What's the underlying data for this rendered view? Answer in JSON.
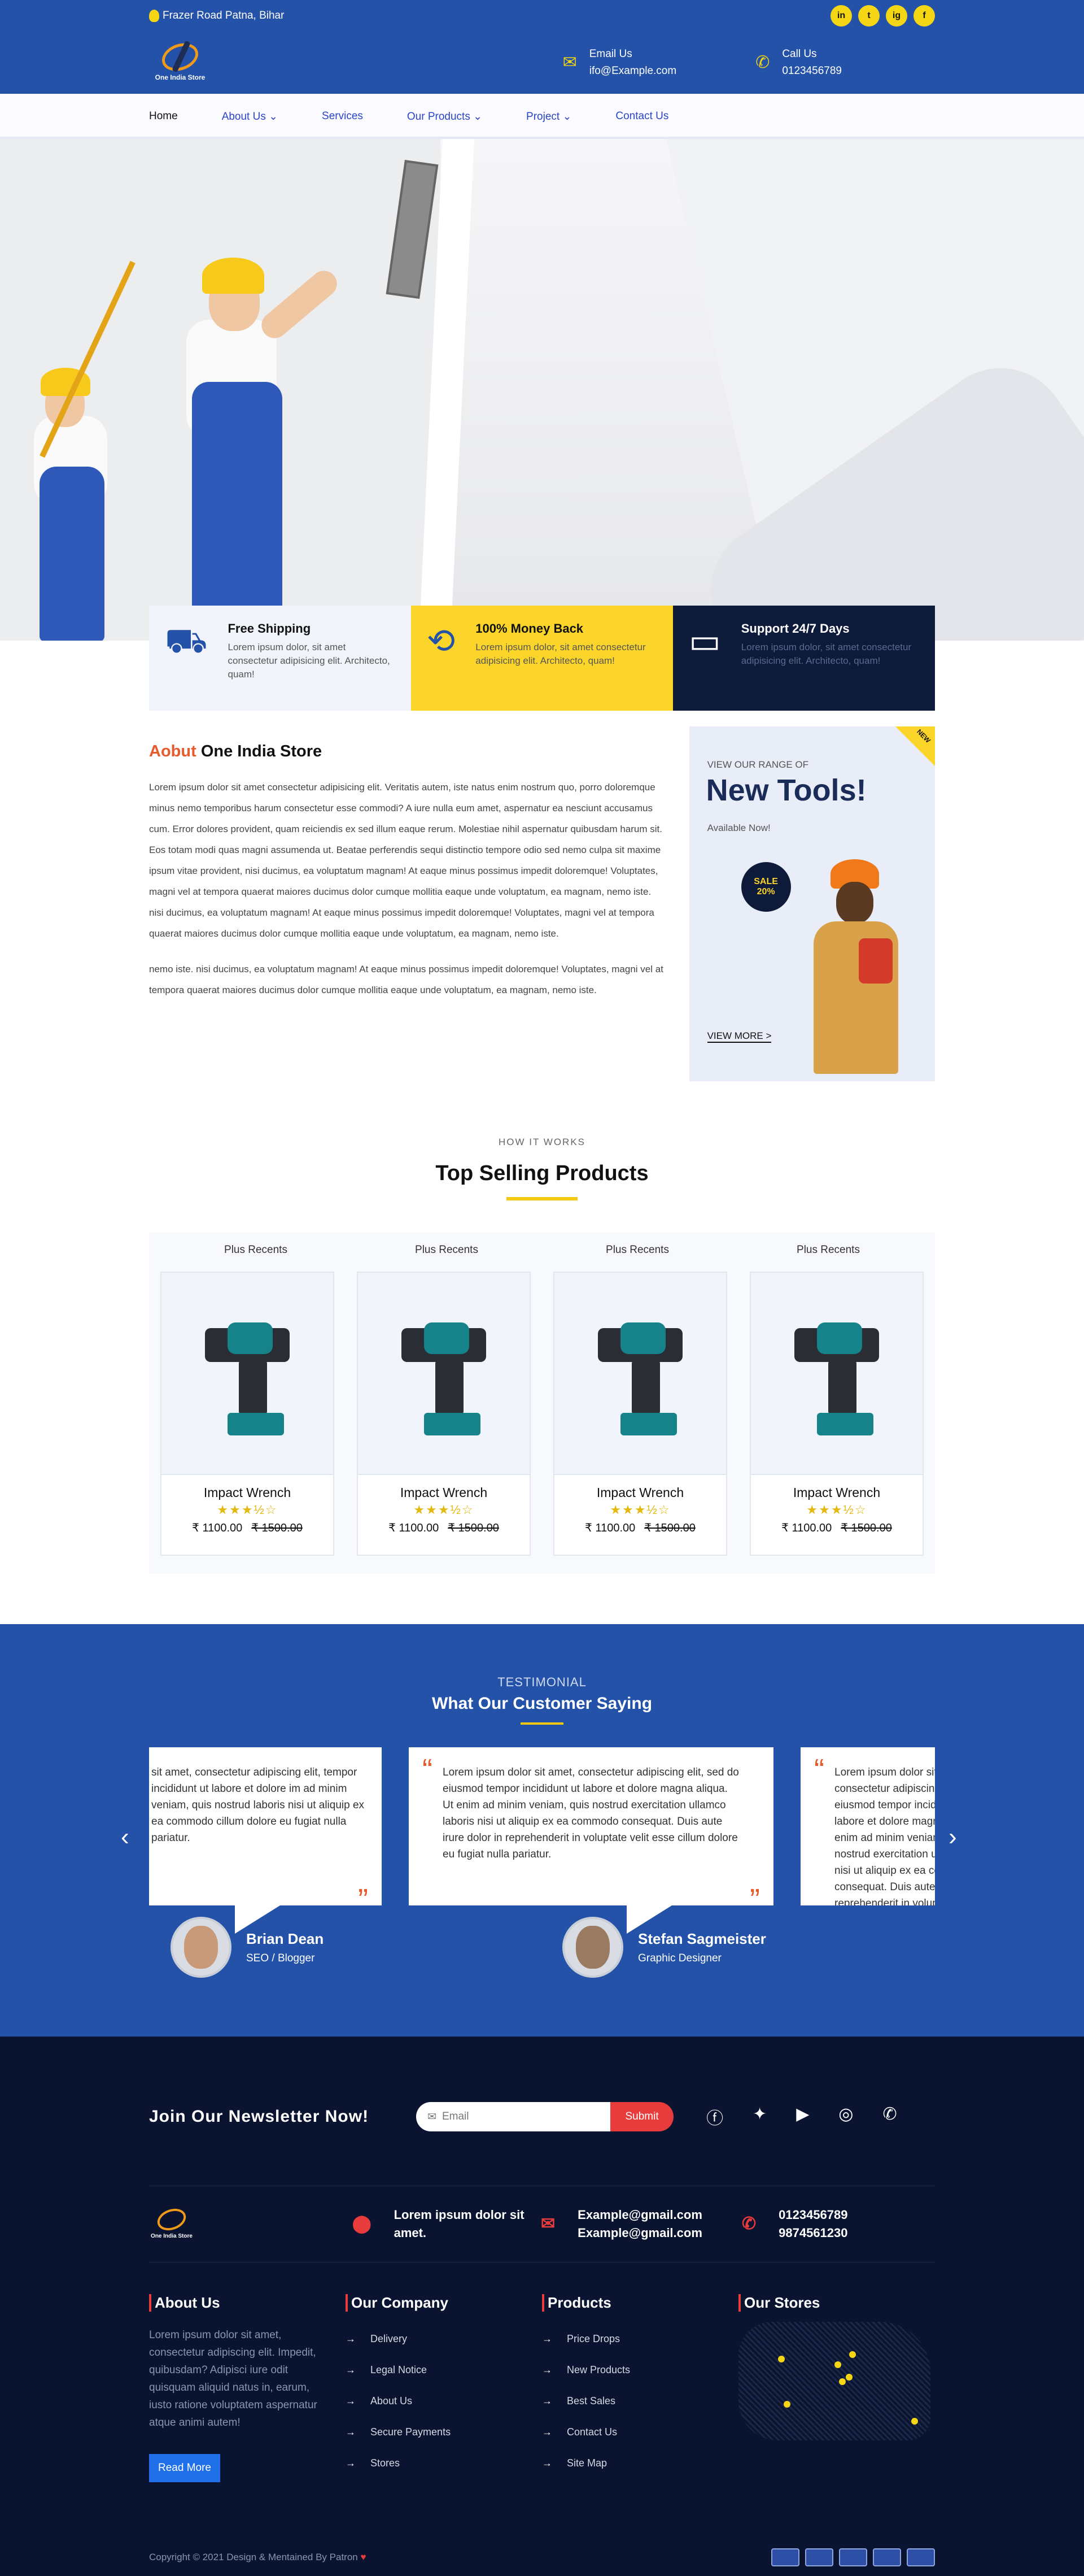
{
  "topbar": {
    "location": "Frazer Road Patna, Bihar",
    "social": [
      "in",
      "t",
      "ig",
      "f"
    ]
  },
  "header": {
    "logo_text": "One India Store",
    "email_label": "Email Us",
    "email_value": "ifo@Example.com",
    "call_label": "Call Us",
    "call_value": "0123456789"
  },
  "nav": [
    "Home",
    "About Us",
    "Services",
    "Our Products",
    "Project",
    "Contact Us"
  ],
  "features": [
    {
      "title": "Free Shipping",
      "text": "Lorem ipsum dolor, sit amet consectetur adipisicing elit. Architecto, quam!"
    },
    {
      "title": "100% Money Back",
      "text": "Lorem ipsum dolor, sit amet consectetur adipisicing elit. Architecto, quam!"
    },
    {
      "title": "Support 24/7 Days",
      "text": "Lorem ipsum dolor, sit amet consectetur adipisicing elit. Architecto, quam!"
    }
  ],
  "about": {
    "title_highlight": "Aobut",
    "title_rest": "One India Store",
    "p1": "Lorem ipsum dolor sit amet consectetur adipisicing elit. Veritatis autem, iste natus enim nostrum quo, porro doloremque minus nemo temporibus harum consectetur esse commodi? A iure nulla eum amet, aspernatur ea nesciunt accusamus cum. Error dolores provident, quam reiciendis ex sed illum eaque rerum. Molestiae nihil aspernatur quibusdam harum sit. Eos totam modi quas magni assumenda ut. Beatae perferendis sequi distinctio tempore odio sed nemo culpa sit maxime ipsum vitae provident, nisi ducimus, ea voluptatum magnam! At eaque minus possimus impedit doloremque! Voluptates, magni vel at tempora quaerat maiores ducimus dolor cumque mollitia eaque unde voluptatum, ea magnam, nemo iste. nisi ducimus, ea voluptatum magnam! At eaque minus possimus impedit doloremque! Voluptates, magni vel at tempora quaerat maiores ducimus dolor cumque mollitia eaque unde voluptatum, ea magnam, nemo iste.",
    "p2": "nemo iste. nisi ducimus, ea voluptatum magnam! At eaque minus possimus impedit doloremque! Voluptates, magni vel at tempora quaerat maiores ducimus dolor cumque mollitia eaque unde voluptatum, ea magnam, nemo iste."
  },
  "promo": {
    "badge": "NEW",
    "range": "VIEW OUR RANGE OF",
    "title": "New Tools!",
    "available": "Available Now!",
    "sale": "SALE",
    "sale_pct": "20%",
    "view_more": "VIEW MORE >"
  },
  "top_selling": {
    "subtitle": "HOW IT WORKS",
    "title": "Top Selling Products",
    "tabs": [
      "Plus Recents",
      "Plus Recents",
      "Plus Recents",
      "Plus Recents"
    ],
    "products": [
      {
        "name": "Impact Wrench",
        "stars": "★★★½☆",
        "price": "₹ 1100.00",
        "old": "₹ 1500.00"
      },
      {
        "name": "Impact Wrench",
        "stars": "★★★½☆",
        "price": "₹ 1100.00",
        "old": "₹ 1500.00"
      },
      {
        "name": "Impact Wrench",
        "stars": "★★★½☆",
        "price": "₹ 1100.00",
        "old": "₹ 1500.00"
      },
      {
        "name": "Impact Wrench",
        "stars": "★★★½☆",
        "price": "₹ 1100.00",
        "old": "₹ 1500.00"
      }
    ]
  },
  "testimonial": {
    "label": "TESTIMONIAL",
    "title": "What Our Customer Saying",
    "left_text": "sit amet, consectetur adipiscing elit, tempor incididunt ut labore et dolore im ad minim veniam, quis nostrud laboris nisi ut aliquip ex ea commodo cillum dolore eu fugiat nulla pariatur.",
    "center_text": "Lorem ipsum dolor sit amet, consectetur adipiscing elit, sed do eiusmod tempor incididunt ut labore et dolore magna aliqua. Ut enim ad minim veniam, quis nostrud exercitation ullamco laboris nisi ut aliquip ex ea commodo consequat. Duis aute irure dolor in reprehenderit in voluptate velit esse cillum dolore eu fugiat nulla pariatur.",
    "right_text": "Lorem ipsum dolor sit amet, consectetur adipiscing elit, sed do eiusmod tempor incididunt ut labore et dolore magna aliqua. Ut enim ad minim veniam, quis nostrud exercitation ullamco laboris nisi ut aliquip ex ea commodo consequat. Duis aute irure dolor in reprehenderit in voluptate velit esse",
    "people": [
      {
        "name": "Brian Dean",
        "role": "SEO / Blogger"
      },
      {
        "name": "Stefan Sagmeister",
        "role": "Graphic Designer"
      }
    ]
  },
  "footer": {
    "newsletter_title": "Join Our Newsletter Now!",
    "email_placeholder": "Email",
    "submit": "Submit",
    "logo_text": "One India Store",
    "address": "Lorem ipsum dolor sit amet.",
    "email1": "Example@gmail.com",
    "email2": "Example@gmail.com",
    "phone1": "0123456789",
    "phone2": "9874561230",
    "about_title": "About Us",
    "about_text": "Lorem ipsum dolor sit amet, consectetur adipiscing elit. Impedit, quibusdam? Adipisci iure odit quisquam aliquid natus in, earum, iusto ratione voluptatem aspernatur atque animi autem!",
    "read_more": "Read More",
    "company_title": "Our Company",
    "company_links": [
      "Delivery",
      "Legal Notice",
      "About Us",
      "Secure Payments",
      "Stores"
    ],
    "products_title": "Products",
    "product_links": [
      "Price Drops",
      "New Products",
      "Best Sales",
      "Contact Us",
      "Site Map"
    ],
    "stores_title": "Our Stores",
    "copyright": "Copyright © 2021 Design & Mentained By Patron"
  }
}
